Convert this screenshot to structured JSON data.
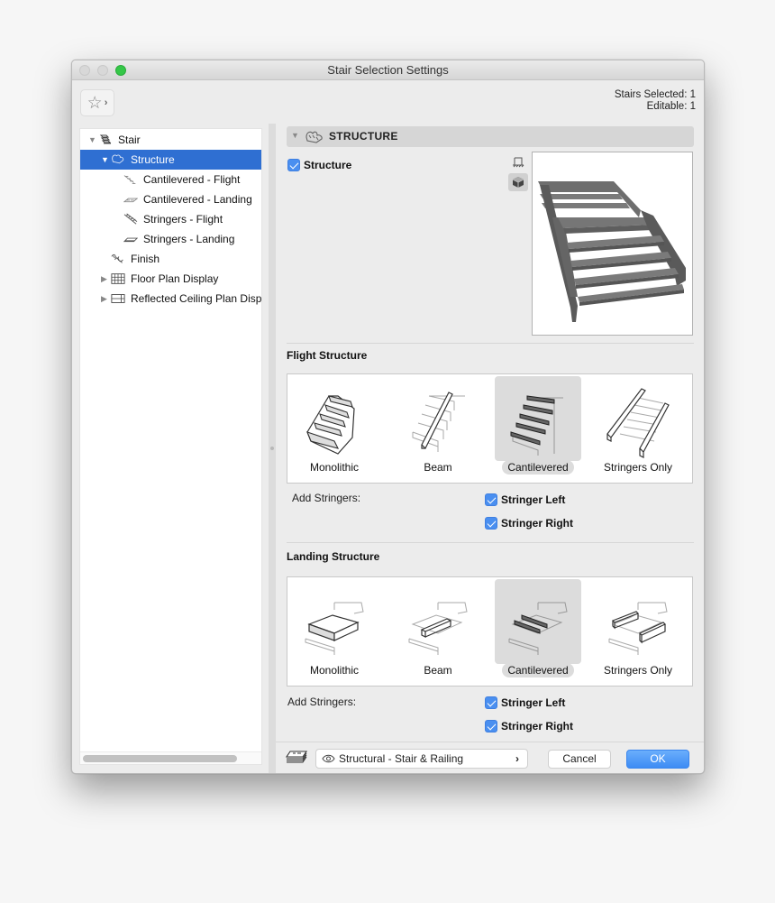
{
  "window": {
    "title": "Stair Selection Settings"
  },
  "favorites": {
    "icon": "star-icon",
    "chevron": "›"
  },
  "selection_info": {
    "stairs_selected": "Stairs Selected: 1",
    "editable": "Editable: 1"
  },
  "tree": {
    "items": [
      {
        "label": "Stair",
        "icon": "stair-icon",
        "expanded": true,
        "level": 0
      },
      {
        "label": "Structure",
        "icon": "structure-icon",
        "expanded": true,
        "selected": true,
        "level": 1
      },
      {
        "label": "Cantilevered - Flight",
        "icon": "cantilevered-flight-icon",
        "level": 2
      },
      {
        "label": "Cantilevered - Landing",
        "icon": "cantilevered-landing-icon",
        "level": 2
      },
      {
        "label": "Stringers - Flight",
        "icon": "stringers-flight-icon",
        "level": 2
      },
      {
        "label": "Stringers - Landing",
        "icon": "stringers-landing-icon",
        "level": 2
      },
      {
        "label": "Finish",
        "icon": "finish-icon",
        "level": 1
      },
      {
        "label": "Floor Plan Display",
        "icon": "floor-plan-icon",
        "expanded": false,
        "level": 1
      },
      {
        "label": "Reflected Ceiling Plan Displ",
        "icon": "ceiling-plan-icon",
        "expanded": false,
        "level": 1
      }
    ]
  },
  "panel": {
    "title": "STRUCTURE",
    "structure_checkbox": {
      "label": "Structure",
      "checked": true
    },
    "view_buttons": [
      {
        "icon": "floor-plan-view-icon",
        "active": false
      },
      {
        "icon": "3d-view-icon",
        "active": true
      }
    ]
  },
  "flight_structure": {
    "title": "Flight Structure",
    "options": [
      "Monolithic",
      "Beam",
      "Cantilevered",
      "Stringers Only"
    ],
    "selected": "Cantilevered",
    "add_stringers_label": "Add Stringers:",
    "stringer_left": {
      "label": "Stringer Left",
      "checked": true
    },
    "stringer_right": {
      "label": "Stringer Right",
      "checked": true
    }
  },
  "landing_structure": {
    "title": "Landing Structure",
    "options": [
      "Monolithic",
      "Beam",
      "Cantilevered",
      "Stringers Only"
    ],
    "selected": "Cantilevered",
    "add_stringers_label": "Add Stringers:",
    "stringer_left": {
      "label": "Stringer Left",
      "checked": true
    },
    "stringer_right": {
      "label": "Stringer Right",
      "checked": true
    }
  },
  "footer": {
    "layer_value": "Structural - Stair & Railing",
    "layer_chevron": "›",
    "cancel_label": "Cancel",
    "ok_label": "OK"
  },
  "colors": {
    "accent": "#2f6fd2",
    "ok_button": "#3e8cf4",
    "checkbox": "#4a8ff0",
    "selected_option_bg": "#dcdcdc"
  }
}
